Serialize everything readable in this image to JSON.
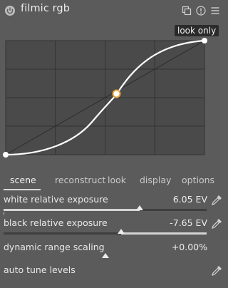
{
  "module": {
    "title": "filmic rgb",
    "icons": [
      "power-icon",
      "presets-icon",
      "reset-icon",
      "menu-icon"
    ]
  },
  "graph": {
    "badge": "look only",
    "icons": [
      "grid",
      "identity-line",
      "tone-curve",
      "contrast-node"
    ]
  },
  "tabs": [
    {
      "label": "scene",
      "active": true
    },
    {
      "label": "reconstruct",
      "active": false
    },
    {
      "label": "look",
      "active": false
    },
    {
      "label": "display",
      "active": false
    },
    {
      "label": "options",
      "active": false
    }
  ],
  "sliders": {
    "white": {
      "label": "white relative exposure",
      "value": "6.05 EV",
      "fraction": 0.67,
      "picker_icon": "color-picker-icon"
    },
    "black": {
      "label": "black relative exposure",
      "value": "-7.65 EV",
      "fraction": 0.58,
      "picker_icon": "color-picker-icon"
    },
    "dynamic": {
      "label": "dynamic range scaling",
      "value": "+0.00%",
      "fraction": 0.5
    }
  },
  "auto_tune": {
    "label": "auto tune levels",
    "picker_icon": "color-picker-icon"
  },
  "colors": {
    "background": "#5b5b5b",
    "graph_bg": "#4a4a4a",
    "curve": "#ffffff",
    "node_accent": "#e8a33a",
    "badge_bg": "#2b2b2b"
  }
}
